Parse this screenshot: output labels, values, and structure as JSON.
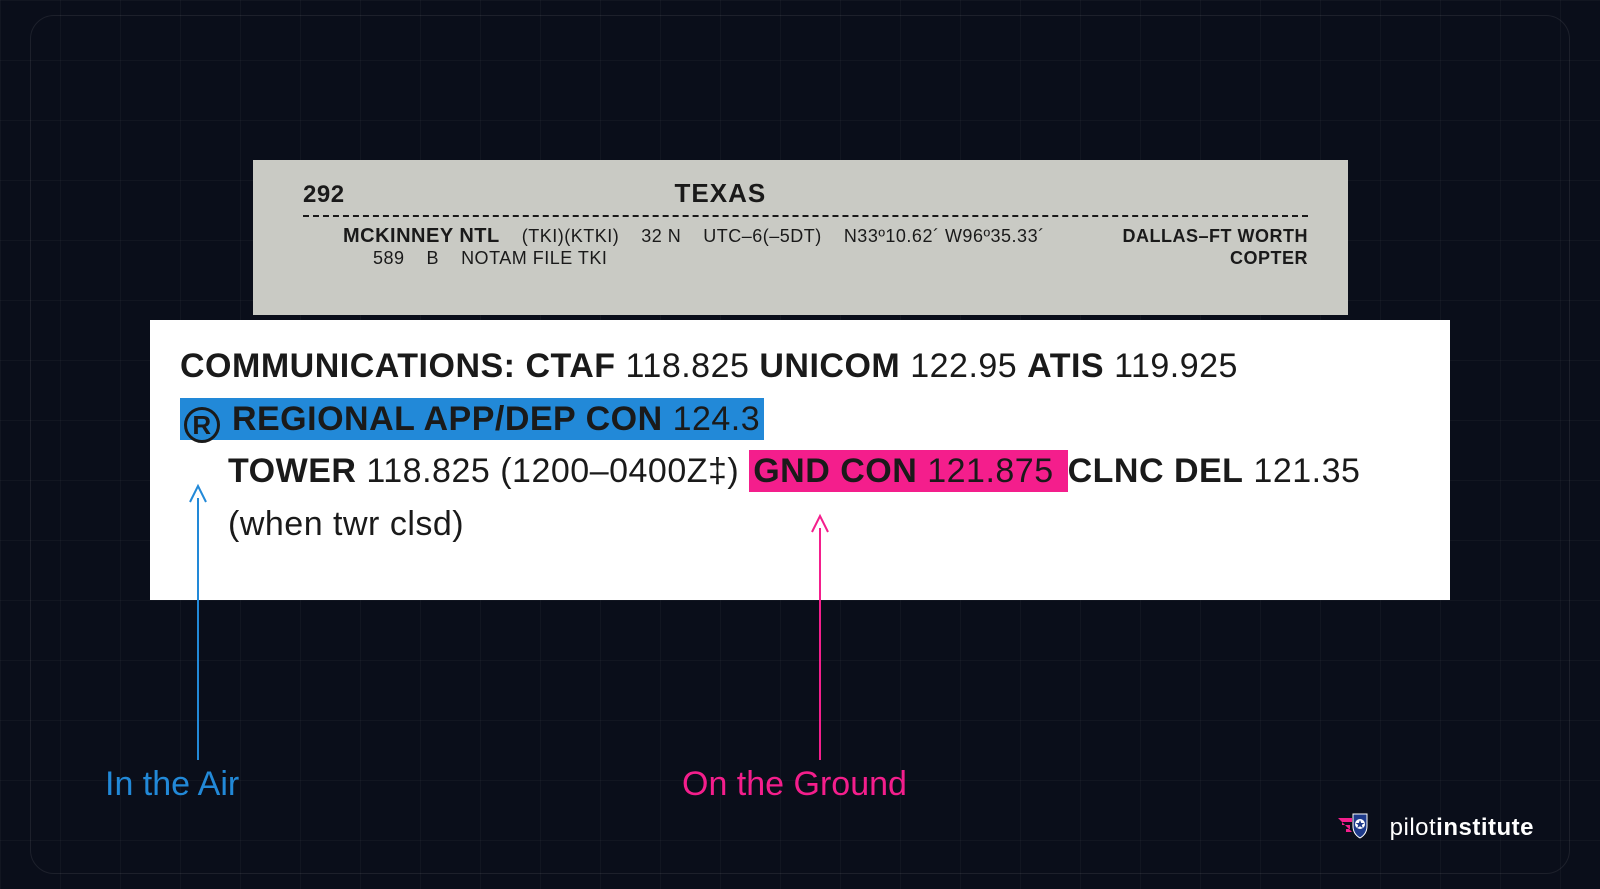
{
  "header": {
    "page_number": "292",
    "region": "TEXAS",
    "airport_name": "MCKINNEY NTL",
    "identifiers": "(TKI)(KTKI)",
    "distance": "32 N",
    "utc": "UTC–6(–5DT)",
    "coords": "N33º10.62´ W96º35.33´",
    "sectional": "DALLAS–FT WORTH",
    "elevation": "589",
    "fuel": "B",
    "notam": "NOTAM FILE TKI",
    "copter": "COPTER"
  },
  "comms": {
    "heading": "COMMUNICATIONS:",
    "ctaf_label": "CTAF",
    "ctaf_freq": "118.825",
    "unicom_label": "UNICOM",
    "unicom_freq": "122.95",
    "atis_label": "ATIS",
    "atis_freq": "119.925",
    "reg_symbol": "R",
    "regional_label": "REGIONAL APP/DEP CON",
    "regional_freq": "124.3",
    "tower_label": "TOWER",
    "tower_freq": "118.825",
    "tower_hours": "(1200–0400Z‡)",
    "gnd_label": "GND CON",
    "gnd_freq": "121.875",
    "clnc_label": "CLNC DEL",
    "clnc_freq": "121.35",
    "note": "(when twr clsd)"
  },
  "annotations": {
    "air_label": "In the Air",
    "ground_label": "On the Ground"
  },
  "colors": {
    "blue": "#2289d8",
    "pink": "#f41e8c",
    "bg": "#0a0e1a"
  },
  "brand": {
    "word1": "pilot",
    "word2": "institute"
  }
}
